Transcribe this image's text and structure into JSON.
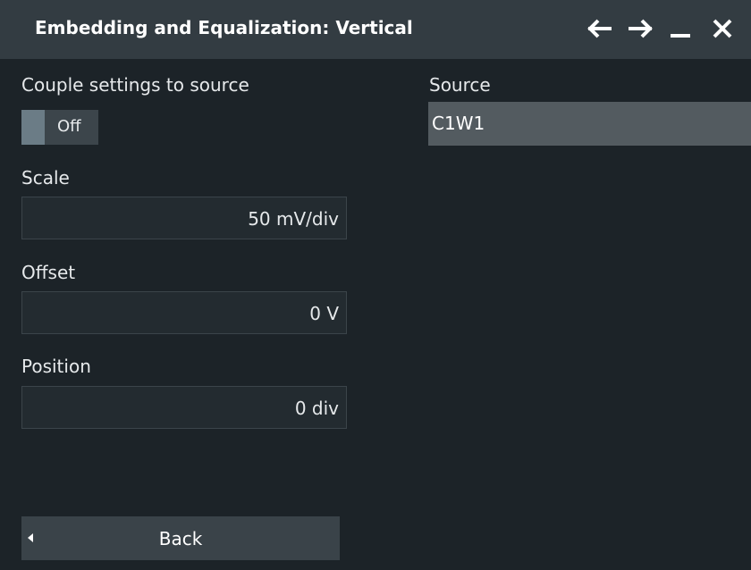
{
  "window": {
    "title": "Embedding and Equalization: Vertical",
    "icons": [
      "arrow-left-icon",
      "arrow-right-icon",
      "minimize-icon",
      "close-icon"
    ]
  },
  "couple": {
    "label": "Couple settings to source",
    "state": "Off"
  },
  "source": {
    "label": "Source",
    "value": "C1W1"
  },
  "scale": {
    "label": "Scale",
    "value": "50 mV/div"
  },
  "offset": {
    "label": "Offset",
    "value": "0 V"
  },
  "position": {
    "label": "Position",
    "value": "0 div"
  },
  "back": {
    "label": "Back"
  },
  "colors": {
    "background": "#1c2328",
    "titlebar": "#333c42",
    "field": "#232b30",
    "source_field": "#535b60",
    "button": "#3a4349"
  }
}
